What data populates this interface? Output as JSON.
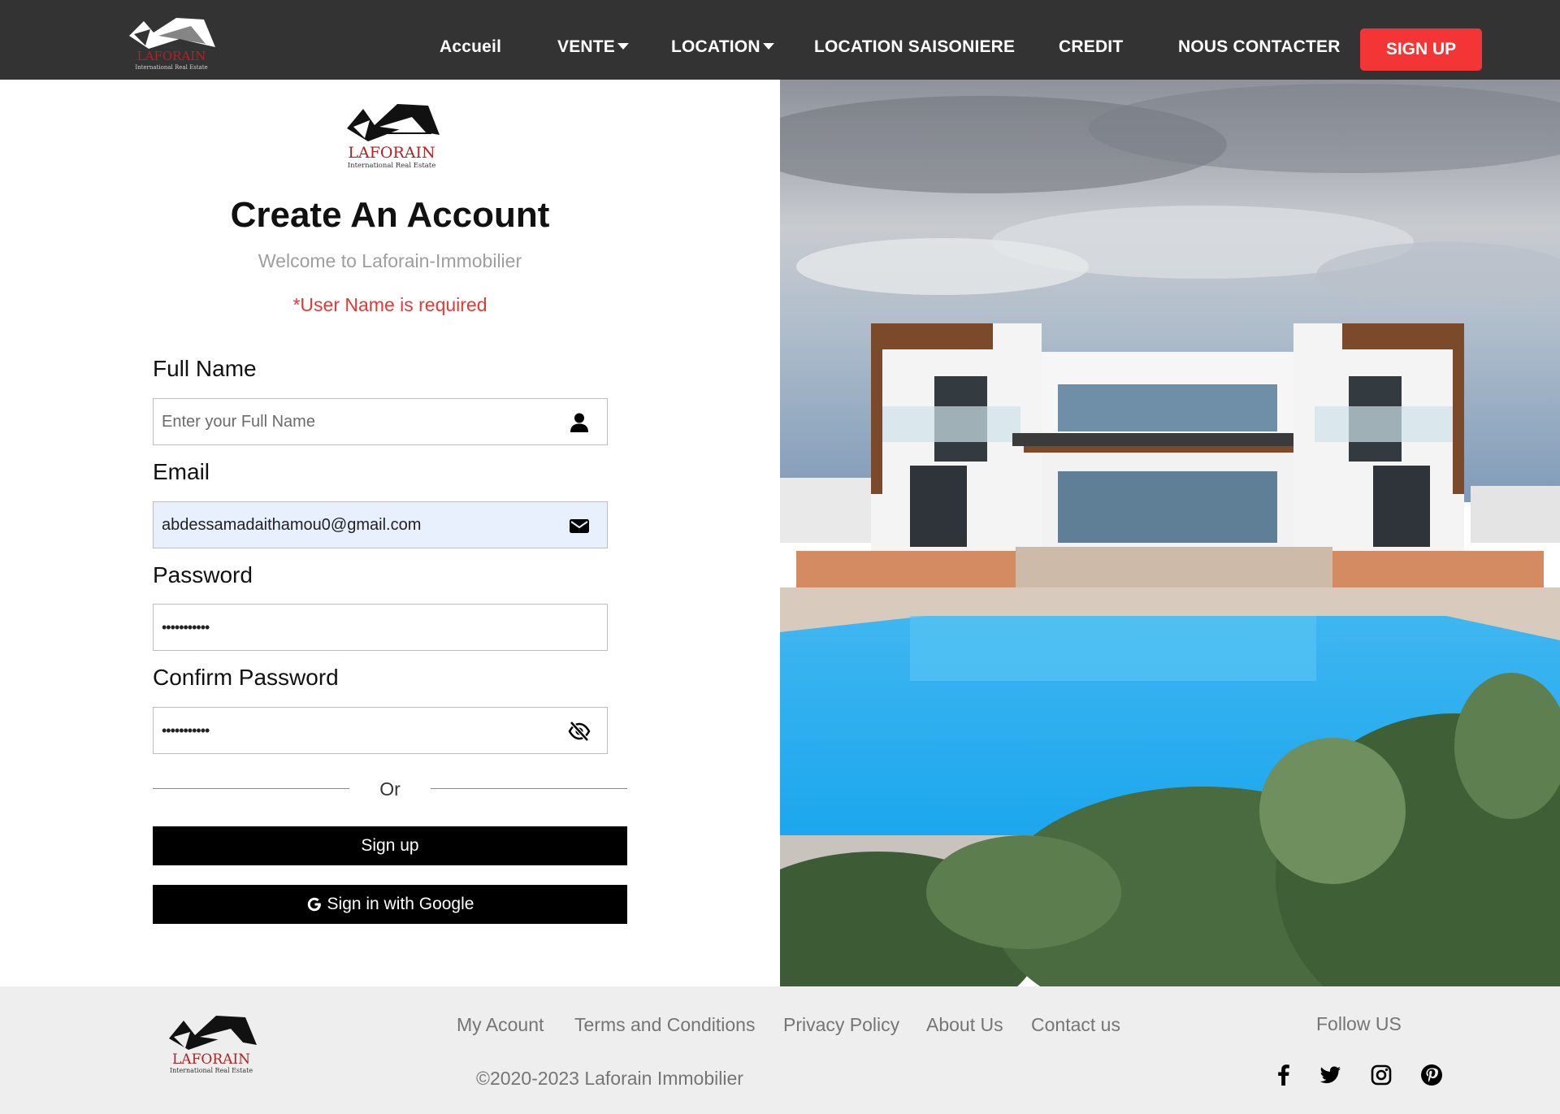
{
  "brand": {
    "name": "LAFORAIN",
    "tagline": "International Real Estate",
    "color": "#b22222"
  },
  "nav": {
    "items": [
      {
        "label": "Accueil"
      },
      {
        "label": "VENTE"
      },
      {
        "label": "LOCATION"
      },
      {
        "label": "LOCATION SAISONIERE"
      },
      {
        "label": "CREDIT"
      },
      {
        "label": "NOUS CONTACTER"
      }
    ],
    "signup_label": "SIGN UP",
    "signup_color": "#f43535"
  },
  "form": {
    "title": "Create An Account",
    "subtitle": "Welcome to Laforain-Immobilier",
    "error": "*User Name is required",
    "fields": {
      "full_name": {
        "label": "Full Name",
        "placeholder": "Enter your Full Name",
        "value": "",
        "icon": "user-icon"
      },
      "email": {
        "label": "Email",
        "placeholder": "",
        "value": "abdessamadaithamou0@gmail.com",
        "icon": "envelope-icon"
      },
      "password": {
        "label": "Password",
        "value": "•••••••••••"
      },
      "confirm_password": {
        "label": "Confirm Password",
        "value": "•••••••••••",
        "icon": "eye-slash-icon"
      }
    },
    "divider_text": "Or",
    "signup_button": "Sign up",
    "google_button": "Sign in with Google"
  },
  "footer": {
    "links": [
      "My Acount",
      "Terms and Conditions",
      "Privacy Policy",
      "About Us",
      "Contact us"
    ],
    "copyright": "©2020-2023 Laforain Immobilier",
    "follow_label": "Follow US",
    "social": [
      "facebook-icon",
      "twitter-icon",
      "instagram-icon",
      "pinterest-icon"
    ]
  }
}
